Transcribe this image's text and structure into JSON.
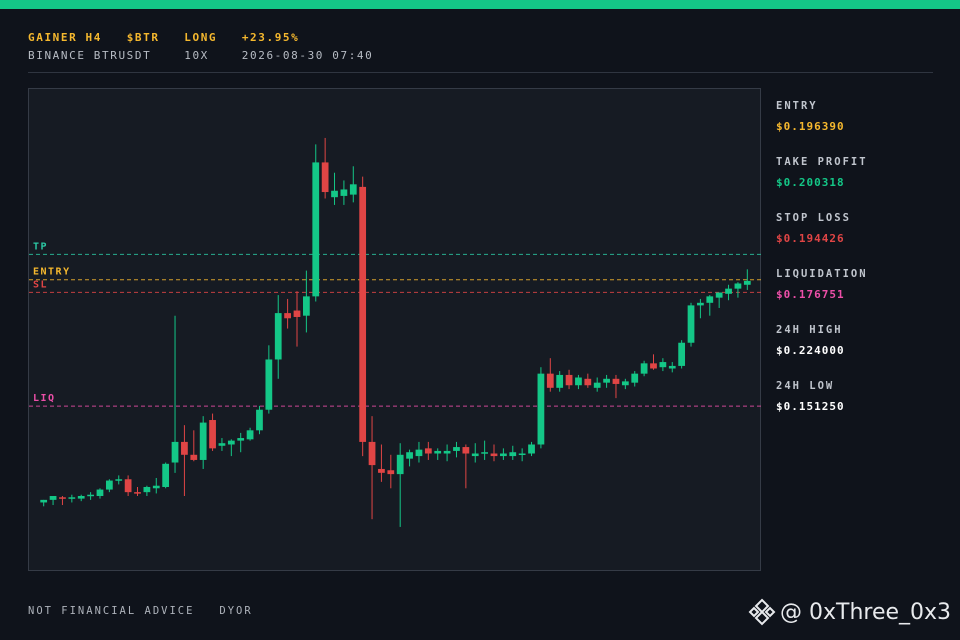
{
  "header": {
    "line1": [
      "GAINER H4",
      "$BTR",
      "LONG",
      "+23.95%"
    ],
    "line2": [
      "BINANCE BTRUSDT",
      "10X",
      "2026-08-30 07:40"
    ]
  },
  "colors": {
    "accent_green": "#14c787",
    "red": "#e04545",
    "gold": "#f5b82e",
    "pink": "#ec4fa8"
  },
  "levels": [
    {
      "label": "TP",
      "price": 0.200318,
      "color": "#2bc7a3"
    },
    {
      "label": "ENTRY",
      "price": 0.19639,
      "color": "#f5b82e"
    },
    {
      "label": "SL",
      "price": 0.194426,
      "color": "#e04545"
    },
    {
      "label": "LIQ",
      "price": 0.176751,
      "color": "#ec4fa8"
    }
  ],
  "stats": [
    {
      "label": "ENTRY",
      "value": "$0.196390",
      "color": "#f5b82e"
    },
    {
      "label": "TAKE PROFIT",
      "value": "$0.200318",
      "color": "#14c787"
    },
    {
      "label": "STOP LOSS",
      "value": "$0.194426",
      "color": "#e04545"
    },
    {
      "label": "LIQUIDATION",
      "value": "$0.176751",
      "color": "#ec4fa8"
    },
    {
      "label": "24H HIGH",
      "value": "$0.224000",
      "color": "#ffffff"
    },
    {
      "label": "24H LOW",
      "value": "$0.151250",
      "color": "#ffffff"
    }
  ],
  "footer": [
    "NOT FINANCIAL ADVICE",
    "DYOR"
  ],
  "brand": {
    "handle": "@ 0xThree_0x3",
    "logo_icon": "binance-diamond-icon"
  },
  "chart_data": {
    "type": "candlestick",
    "ylim": [
      0.151,
      0.226
    ],
    "candles": [
      [
        0.1618,
        0.1622,
        0.1612,
        0.1622
      ],
      [
        0.1622,
        0.1628,
        0.1614,
        0.1628
      ],
      [
        0.1626,
        0.1628,
        0.1614,
        0.1624
      ],
      [
        0.1624,
        0.163,
        0.1618,
        0.1626
      ],
      [
        0.1624,
        0.163,
        0.162,
        0.1628
      ],
      [
        0.1628,
        0.1634,
        0.1622,
        0.163
      ],
      [
        0.1628,
        0.164,
        0.1624,
        0.1638
      ],
      [
        0.1638,
        0.1654,
        0.1634,
        0.1652
      ],
      [
        0.1652,
        0.166,
        0.1646,
        0.1654
      ],
      [
        0.1654,
        0.166,
        0.1628,
        0.1634
      ],
      [
        0.1634,
        0.1642,
        0.1628,
        0.1632
      ],
      [
        0.1634,
        0.1644,
        0.1628,
        0.1642
      ],
      [
        0.164,
        0.1656,
        0.1632,
        0.1644
      ],
      [
        0.1642,
        0.168,
        0.164,
        0.1678
      ],
      [
        0.168,
        0.1908,
        0.1664,
        0.1712
      ],
      [
        0.1712,
        0.1738,
        0.1628,
        0.1692
      ],
      [
        0.1692,
        0.173,
        0.1682,
        0.1684
      ],
      [
        0.1684,
        0.1752,
        0.167,
        0.1742
      ],
      [
        0.1746,
        0.1756,
        0.1698,
        0.1702
      ],
      [
        0.1706,
        0.1718,
        0.1698,
        0.171
      ],
      [
        0.1708,
        0.1716,
        0.169,
        0.1714
      ],
      [
        0.1714,
        0.1726,
        0.1696,
        0.1718
      ],
      [
        0.1716,
        0.1734,
        0.1714,
        0.173
      ],
      [
        0.173,
        0.1768,
        0.1724,
        0.1762
      ],
      [
        0.1762,
        0.1862,
        0.1756,
        0.184
      ],
      [
        0.184,
        0.194,
        0.181,
        0.1912
      ],
      [
        0.1912,
        0.1934,
        0.1888,
        0.1904
      ],
      [
        0.1916,
        0.1946,
        0.186,
        0.1906
      ],
      [
        0.1908,
        0.1978,
        0.1882,
        0.1938
      ],
      [
        0.1938,
        0.2174,
        0.193,
        0.2146
      ],
      [
        0.2146,
        0.2184,
        0.209,
        0.21
      ],
      [
        0.2092,
        0.213,
        0.208,
        0.2102
      ],
      [
        0.2094,
        0.2118,
        0.208,
        0.2104
      ],
      [
        0.2096,
        0.214,
        0.2084,
        0.2112
      ],
      [
        0.2108,
        0.2124,
        0.169,
        0.1712
      ],
      [
        0.1712,
        0.1752,
        0.1592,
        0.1676
      ],
      [
        0.167,
        0.1708,
        0.165,
        0.1664
      ],
      [
        0.1668,
        0.1692,
        0.164,
        0.1662
      ],
      [
        0.1662,
        0.171,
        0.158,
        0.1692
      ],
      [
        0.1686,
        0.17,
        0.1674,
        0.1696
      ],
      [
        0.169,
        0.1712,
        0.168,
        0.17
      ],
      [
        0.1702,
        0.1712,
        0.1684,
        0.1694
      ],
      [
        0.1694,
        0.1702,
        0.1684,
        0.1698
      ],
      [
        0.1694,
        0.1708,
        0.1682,
        0.1698
      ],
      [
        0.1698,
        0.1712,
        0.1688,
        0.1704
      ],
      [
        0.1704,
        0.1708,
        0.164,
        0.1694
      ],
      [
        0.169,
        0.171,
        0.168,
        0.1694
      ],
      [
        0.1694,
        0.1714,
        0.1684,
        0.1696
      ],
      [
        0.1694,
        0.1708,
        0.1682,
        0.169
      ],
      [
        0.169,
        0.1702,
        0.1684,
        0.1694
      ],
      [
        0.169,
        0.1706,
        0.1684,
        0.1696
      ],
      [
        0.1692,
        0.1702,
        0.1682,
        0.1694
      ],
      [
        0.1694,
        0.1712,
        0.169,
        0.1708
      ],
      [
        0.1708,
        0.1828,
        0.1702,
        0.1818
      ],
      [
        0.1818,
        0.1842,
        0.179,
        0.1796
      ],
      [
        0.1796,
        0.1822,
        0.179,
        0.1816
      ],
      [
        0.1816,
        0.1824,
        0.1794,
        0.18
      ],
      [
        0.18,
        0.1816,
        0.1794,
        0.1812
      ],
      [
        0.181,
        0.1818,
        0.1796,
        0.18
      ],
      [
        0.1796,
        0.1812,
        0.179,
        0.1804
      ],
      [
        0.1804,
        0.1816,
        0.1796,
        0.181
      ],
      [
        0.181,
        0.1816,
        0.178,
        0.1802
      ],
      [
        0.18,
        0.181,
        0.1794,
        0.1806
      ],
      [
        0.1804,
        0.1822,
        0.1798,
        0.1818
      ],
      [
        0.1818,
        0.1838,
        0.1814,
        0.1834
      ],
      [
        0.1834,
        0.1848,
        0.1824,
        0.1826
      ],
      [
        0.1828,
        0.1842,
        0.1822,
        0.1836
      ],
      [
        0.1826,
        0.1836,
        0.182,
        0.183
      ],
      [
        0.183,
        0.187,
        0.1826,
        0.1866
      ],
      [
        0.1866,
        0.1928,
        0.186,
        0.1924
      ],
      [
        0.1924,
        0.1934,
        0.1904,
        0.1928
      ],
      [
        0.1928,
        0.194,
        0.1908,
        0.1938
      ],
      [
        0.1936,
        0.1944,
        0.192,
        0.1944
      ],
      [
        0.1942,
        0.1956,
        0.1932,
        0.195
      ],
      [
        0.195,
        0.196,
        0.1936,
        0.1958
      ],
      [
        0.1956,
        0.198,
        0.1948,
        0.1962
      ]
    ]
  }
}
